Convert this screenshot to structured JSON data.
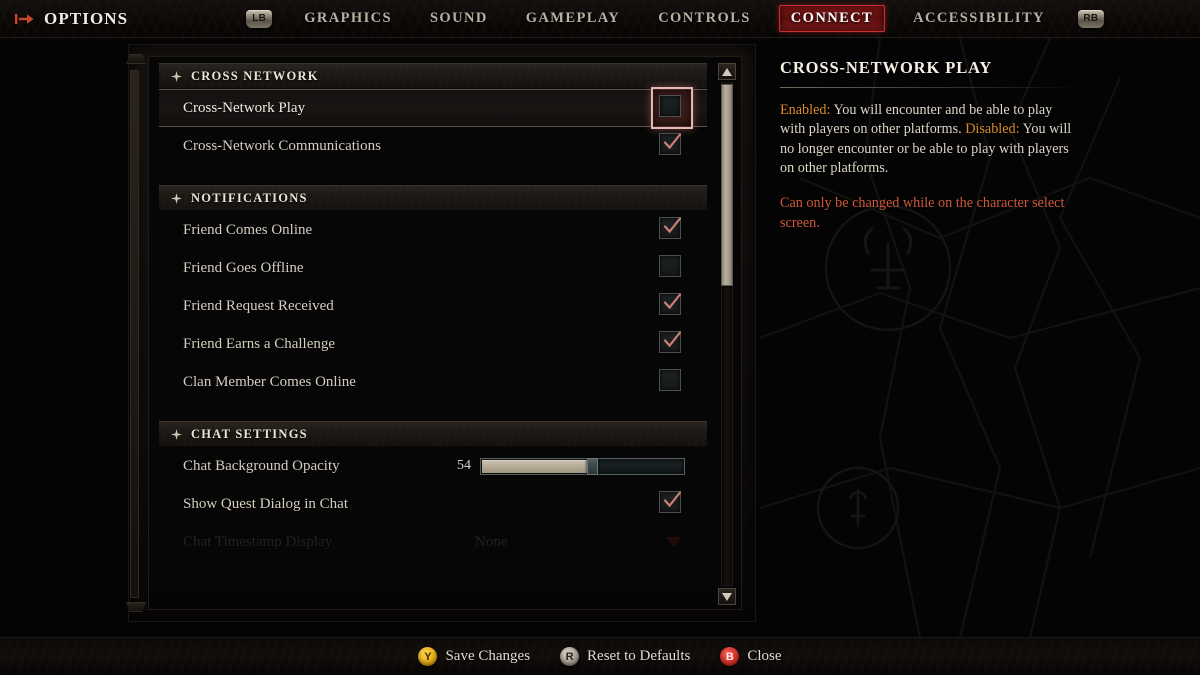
{
  "topbar": {
    "arrow_icon": "options-arrow-icon",
    "title": "OPTIONS",
    "left_bumper": "LB",
    "right_bumper": "RB",
    "tabs": [
      {
        "label": "GRAPHICS",
        "active": false
      },
      {
        "label": "SOUND",
        "active": false
      },
      {
        "label": "GAMEPLAY",
        "active": false
      },
      {
        "label": "CONTROLS",
        "active": false
      },
      {
        "label": "CONNECT",
        "active": true
      },
      {
        "label": "ACCESSIBILITY",
        "active": false
      }
    ]
  },
  "settings": {
    "sections": [
      {
        "title": "CROSS NETWORK",
        "rows": [
          {
            "label": "Cross-Network Play",
            "type": "checkbox",
            "checked": false,
            "selected": true
          },
          {
            "label": "Cross-Network Communications",
            "type": "checkbox",
            "checked": true,
            "selected": false
          }
        ]
      },
      {
        "title": "NOTIFICATIONS",
        "rows": [
          {
            "label": "Friend Comes Online",
            "type": "checkbox",
            "checked": true,
            "selected": false
          },
          {
            "label": "Friend Goes Offline",
            "type": "checkbox",
            "checked": false,
            "selected": false
          },
          {
            "label": "Friend Request Received",
            "type": "checkbox",
            "checked": true,
            "selected": false
          },
          {
            "label": "Friend Earns a Challenge",
            "type": "checkbox",
            "checked": true,
            "selected": false
          },
          {
            "label": "Clan Member Comes Online",
            "type": "checkbox",
            "checked": false,
            "selected": false
          }
        ]
      },
      {
        "title": "CHAT SETTINGS",
        "rows": [
          {
            "label": "Chat Background Opacity",
            "type": "slider",
            "value": 54,
            "min": 0,
            "max": 100
          },
          {
            "label": "Show Quest Dialog in Chat",
            "type": "checkbox",
            "checked": true,
            "selected": false
          },
          {
            "label": "Chat Timestamp Display",
            "type": "dropdown",
            "value": "None",
            "faded": true
          }
        ]
      }
    ],
    "scrollbar": {
      "up_icon": "chevron-up-icon",
      "down_icon": "chevron-down-icon",
      "thumb_top_pct": 0,
      "thumb_height_pct": 40
    }
  },
  "info": {
    "title": "CROSS-NETWORK PLAY",
    "enabled_keyword": "Enabled:",
    "enabled_text": " You will encounter and be able to play with players on other platforms.",
    "disabled_keyword": "Disabled:",
    "disabled_text": " You will no longer encounter or be able to play with players on other platforms.",
    "warning": "Can only be changed while on the character select screen."
  },
  "bottombar": {
    "actions": [
      {
        "glyph": "Y",
        "style": "y",
        "label": "Save Changes"
      },
      {
        "glyph": "R",
        "style": "stick",
        "label": "Reset to Defaults"
      },
      {
        "glyph": "B",
        "style": "b",
        "label": "Close"
      }
    ]
  },
  "colors": {
    "accent_red": "#c53030",
    "keyword_orange": "#d98b2b",
    "warning_red": "#cf5a3a",
    "text_cream": "#ded6c8",
    "slider_fill": "#b3a994"
  }
}
